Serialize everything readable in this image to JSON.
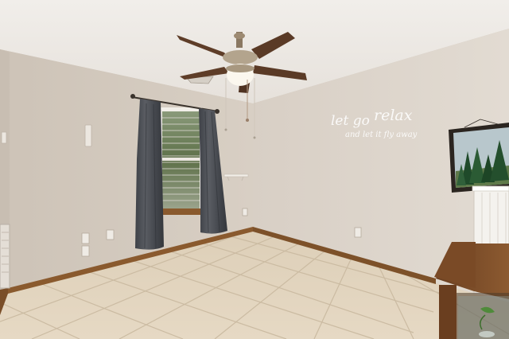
{
  "wall_decal": {
    "line1": "let go",
    "line2": "relax",
    "line3": "and let it fly away"
  },
  "colors": {
    "ceiling": "#eeeae6",
    "left_wall": "#d6cdc2",
    "back_wall": "#d9d0c6",
    "right_wall": "#dcd4ca",
    "floor_tile": "#e2d4bd",
    "grout": "#cfbfa6",
    "baseboard": "#8a5a2e",
    "curtain": "#4c4f55",
    "fan_blade": "#5a3a26",
    "forest_frame": "#2b2520"
  },
  "icons": {
    "ceiling_fan": "ceiling-fan-icon",
    "wall_art": "forest-painting",
    "outlet": "outlet-icon"
  }
}
